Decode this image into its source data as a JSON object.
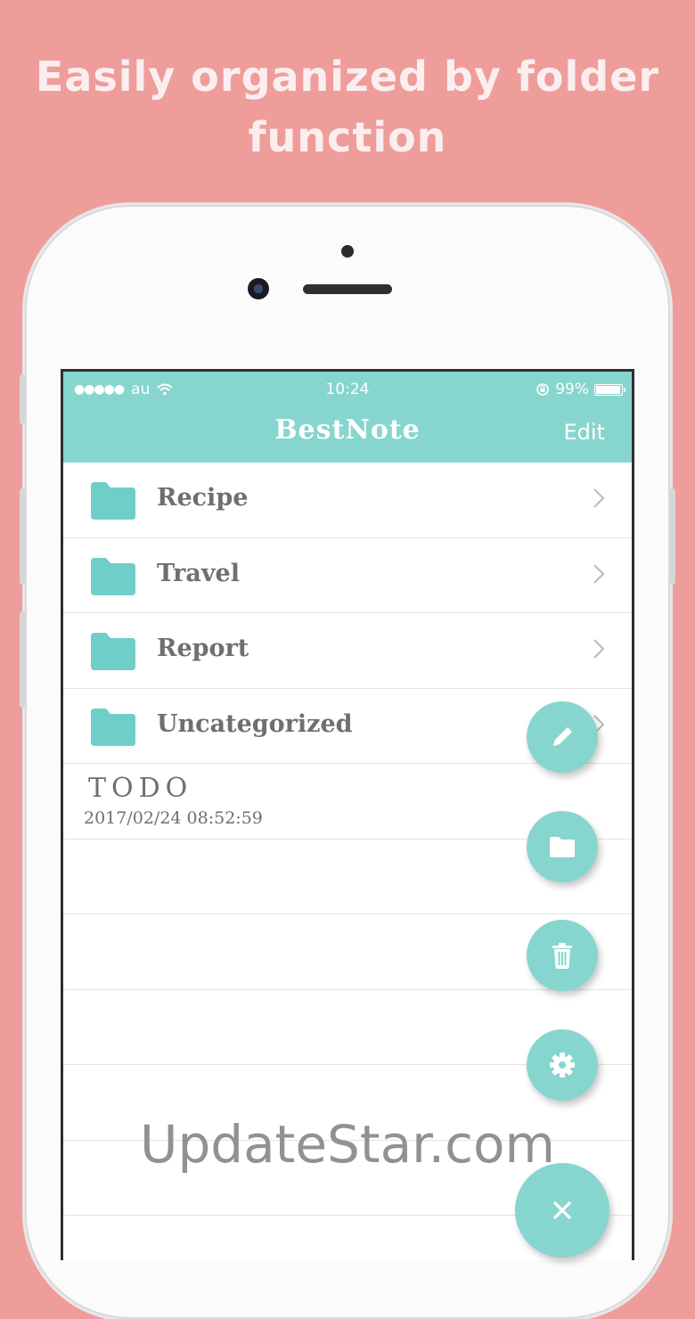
{
  "headline": {
    "line1": "Easily organized by folder",
    "line2": "function"
  },
  "status_bar": {
    "carrier": "au",
    "time": "10:24",
    "battery": "99%"
  },
  "nav": {
    "title": "BestNote",
    "edit_label": "Edit"
  },
  "folders": [
    {
      "label": "Recipe"
    },
    {
      "label": "Travel"
    },
    {
      "label": "Report"
    },
    {
      "label": "Uncategorized"
    }
  ],
  "note": {
    "title": "TODO",
    "date": "2017/02/24 08:52:59"
  },
  "fab_buttons": [
    {
      "icon": "pencil-icon"
    },
    {
      "icon": "folder-icon"
    },
    {
      "icon": "trash-icon"
    },
    {
      "icon": "gear-icon"
    },
    {
      "icon": "close-icon"
    }
  ],
  "watermark": "UpdateStar.com",
  "colors": {
    "background": "#ee9d9b",
    "accent": "#87d5cf",
    "folder": "#6fcfc8",
    "text": "#6f6f6f"
  }
}
